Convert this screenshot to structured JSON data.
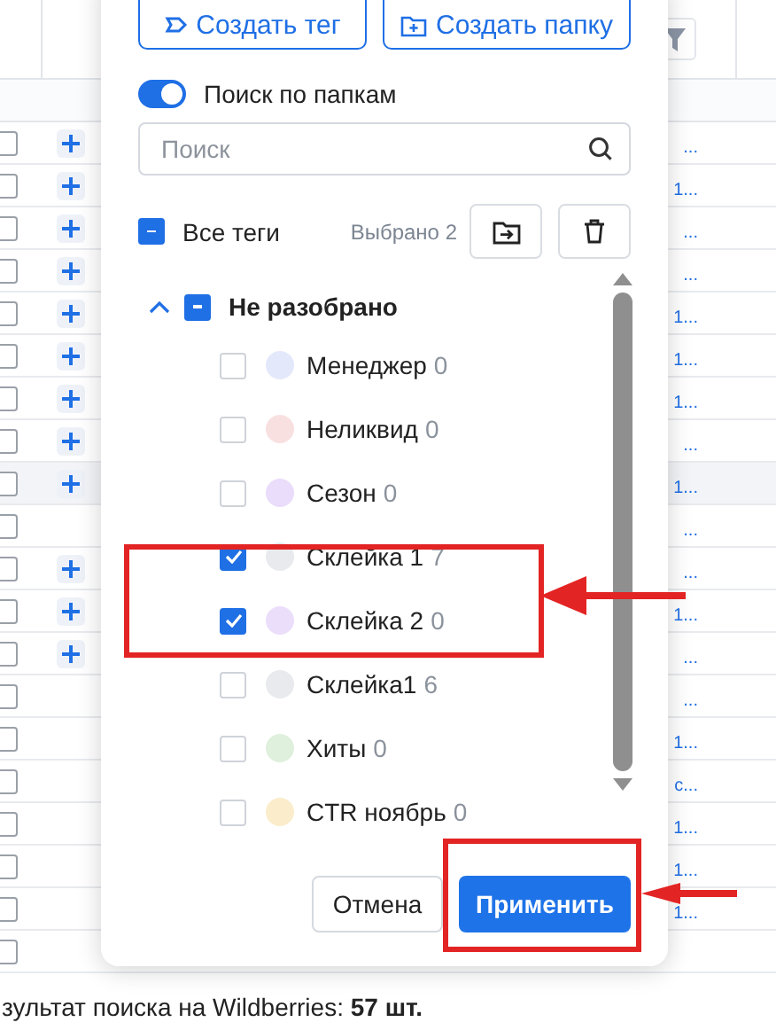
{
  "table": {
    "rows": [
      {
        "selected": false,
        "highlighted": false,
        "add": true,
        "link": "..."
      },
      {
        "selected": false,
        "highlighted": false,
        "add": true,
        "link": "1..."
      },
      {
        "selected": false,
        "highlighted": false,
        "add": true,
        "link": "..."
      },
      {
        "selected": false,
        "highlighted": false,
        "add": true,
        "link": "..."
      },
      {
        "selected": false,
        "highlighted": false,
        "add": true,
        "link": "1..."
      },
      {
        "selected": false,
        "highlighted": false,
        "add": true,
        "link": "1..."
      },
      {
        "selected": false,
        "highlighted": false,
        "add": true,
        "link": "1..."
      },
      {
        "selected": false,
        "highlighted": false,
        "add": true,
        "link": "..."
      },
      {
        "selected": false,
        "highlighted": true,
        "add": true,
        "link": "1..."
      },
      {
        "selected": false,
        "highlighted": false,
        "add": false,
        "link": "..."
      },
      {
        "selected": false,
        "highlighted": false,
        "add": true,
        "link": "..."
      },
      {
        "selected": false,
        "highlighted": false,
        "add": true,
        "link": "1..."
      },
      {
        "selected": false,
        "highlighted": false,
        "add": true,
        "link": "..."
      },
      {
        "selected": false,
        "highlighted": false,
        "add": false,
        "link": "..."
      },
      {
        "selected": false,
        "highlighted": false,
        "add": false,
        "link": "1..."
      },
      {
        "selected": false,
        "highlighted": false,
        "add": false,
        "link": "c..."
      },
      {
        "selected": false,
        "highlighted": false,
        "add": false,
        "link": "1..."
      },
      {
        "selected": false,
        "highlighted": false,
        "add": false,
        "link": "1..."
      },
      {
        "selected": false,
        "highlighted": false,
        "add": false,
        "link": "1..."
      },
      {
        "selected": false,
        "highlighted": false,
        "add": false,
        "link": ""
      }
    ]
  },
  "status_text": "зультат поиска на Wildberries: **57 шт.**",
  "popup": {
    "create_tag": "Создать тег",
    "create_folder": "Создать папку",
    "folder_search": {
      "label": "Поиск по папкам",
      "on": true
    },
    "search": {
      "placeholder": "Поиск"
    },
    "all_tags": {
      "label": "Все теги",
      "partial": true,
      "selected_count": "Выбрано 2"
    },
    "groups": [
      {
        "label": "Не разобрано",
        "expanded": true,
        "partial": true,
        "children": [
          {
            "name": "Менеджер",
            "count": "0",
            "checked": false,
            "color": "#e3e8fb"
          },
          {
            "name": "Неликвид",
            "count": "0",
            "checked": false,
            "color": "#f9e0e0"
          },
          {
            "name": "Сезон",
            "count": "0",
            "checked": false,
            "color": "#eadcfb"
          },
          {
            "name": "Склейка 1",
            "count": "7",
            "checked": true,
            "color": "#e8eaed"
          },
          {
            "name": "Склейка 2",
            "count": "0",
            "checked": true,
            "color": "#ebdefb"
          },
          {
            "name": "Склейка1",
            "count": "6",
            "checked": false,
            "color": "#e8eaed"
          },
          {
            "name": "Хиты",
            "count": "0",
            "checked": false,
            "color": "#dff0dc"
          },
          {
            "name": "CTR ноябрь",
            "count": "0",
            "checked": false,
            "color": "#fbedcc"
          }
        ]
      }
    ],
    "cancel": "Отмена",
    "apply": "Применить"
  }
}
